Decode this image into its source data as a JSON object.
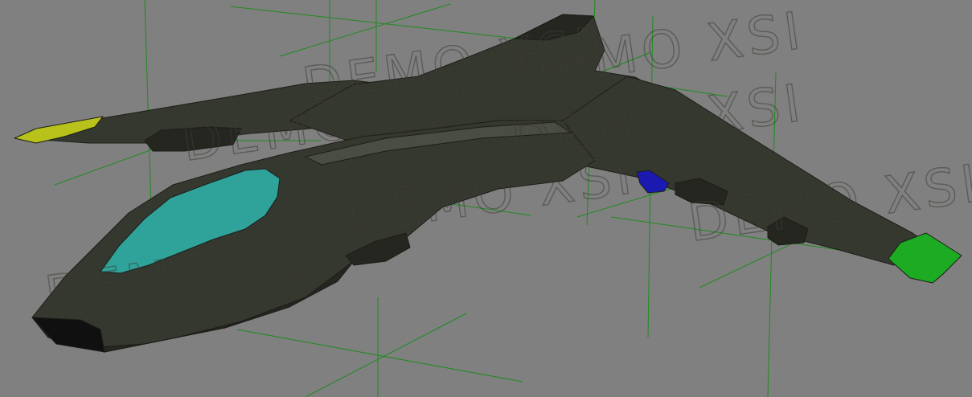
{
  "viewport": {
    "background_color": "#808080",
    "grid_color": "#1e8a1e"
  },
  "model": {
    "hull_color": "#35382f",
    "hull_shadow_color": "#24261f",
    "hull_highlight_color": "#4a4d43",
    "canopy_color": "#2fa39a",
    "left_wingtip_color": "#b8c21a",
    "right_wingtip_color": "#1cab22",
    "thruster_color": "#1a1ab0"
  },
  "watermark": {
    "text": "DEMO XSI"
  }
}
